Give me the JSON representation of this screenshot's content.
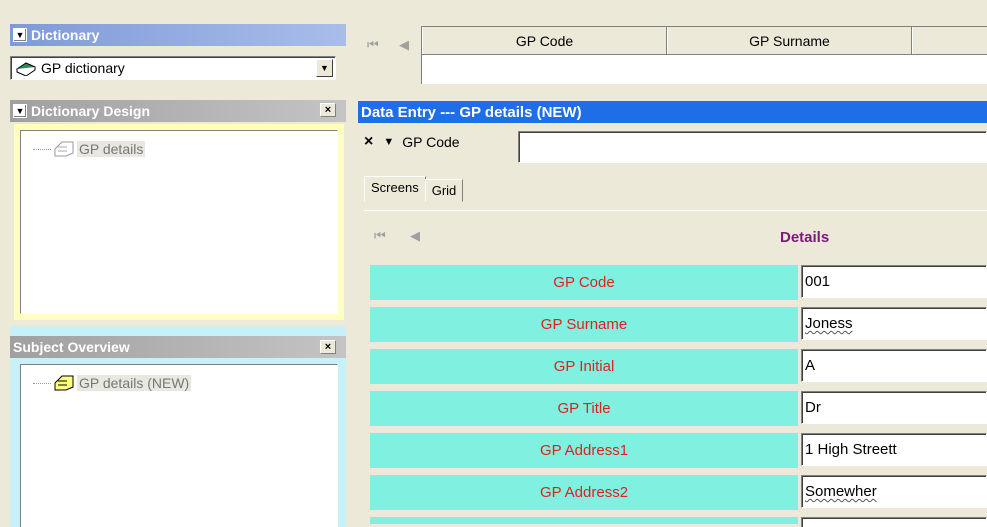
{
  "dictionary_panel": {
    "title": "Dictionary",
    "selected": "GP dictionary"
  },
  "design_panel": {
    "title": "Dictionary Design",
    "tree_item": "GP details"
  },
  "overview_panel": {
    "title": "Subject Overview",
    "tree_item": "GP details (NEW)"
  },
  "top_grid": {
    "columns": [
      "GP Code",
      "GP Surname"
    ]
  },
  "data_entry": {
    "title": "Data Entry --- GP details (NEW)",
    "field_label": "GP Code",
    "field_value": ""
  },
  "tabs": [
    "Screens",
    "Grid"
  ],
  "form": {
    "section_title": "Details",
    "rows": [
      {
        "label": "GP Code",
        "value": "001"
      },
      {
        "label": "GP Surname",
        "value": "Joness"
      },
      {
        "label": "GP Initial",
        "value": "A"
      },
      {
        "label": "GP Title",
        "value": "Dr"
      },
      {
        "label": "GP Address1",
        "value": "1 High Streett"
      },
      {
        "label": "GP Address2",
        "value": "Somewher"
      }
    ]
  },
  "colors": {
    "accent_blue": "#1f6ee8",
    "form_label_bg": "#80f0e0",
    "form_label_text": "#d22",
    "section_title": "#7a1a7a"
  }
}
